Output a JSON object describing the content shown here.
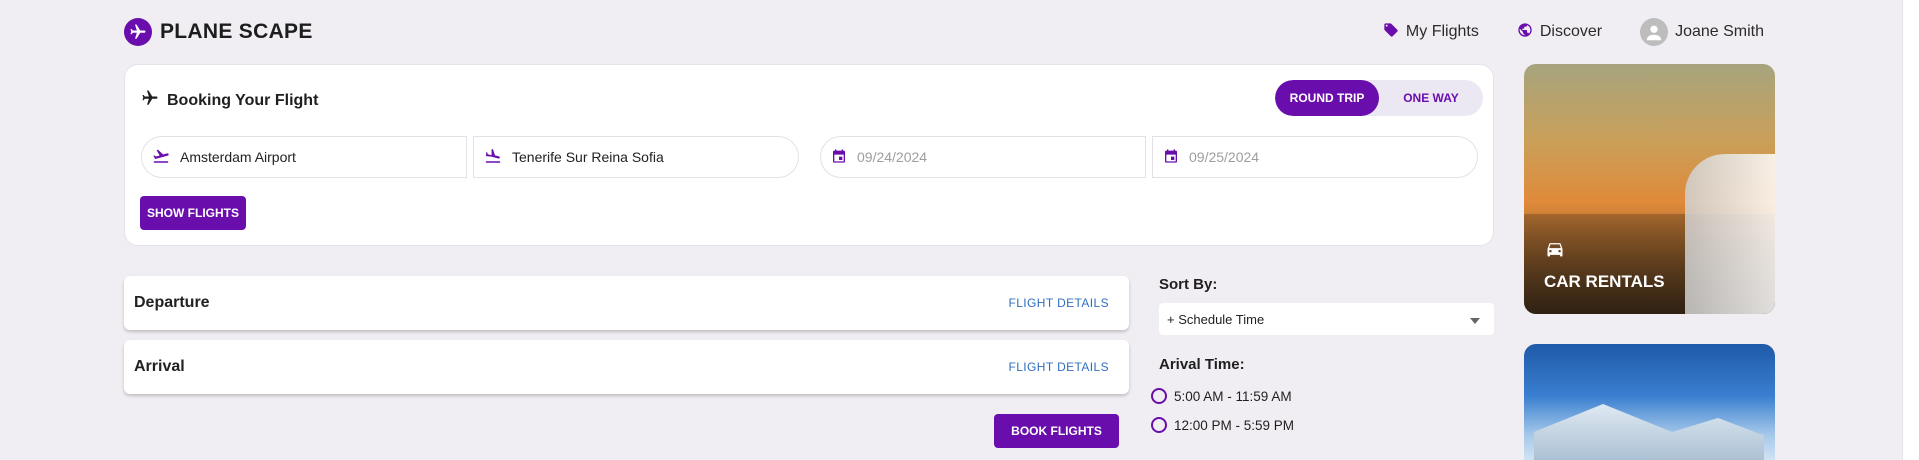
{
  "app": {
    "name": "PLANE SCAPE"
  },
  "nav": {
    "my_flights": "My Flights",
    "discover": "Discover",
    "user_name": "Joane Smith"
  },
  "booking": {
    "title": "Booking Your Flight",
    "trip_types": [
      "ROUND TRIP",
      "ONE WAY"
    ],
    "selected_trip_type": "ROUND TRIP",
    "from": "Amsterdam Airport",
    "to": "Tenerife Sur Reina Sofia",
    "depart_date_placeholder": "09/24/2024",
    "return_date_placeholder": "09/25/2024",
    "show_flights_label": "SHOW FLIGHTS"
  },
  "results": {
    "departure_title": "Departure",
    "arrival_title": "Arrival",
    "flight_details_label": "FLIGHT DETAILS",
    "book_flights_label": "BOOK FLIGHTS"
  },
  "filters": {
    "sort_label": "Sort By:",
    "sort_value": "+ Schedule Time",
    "arrival_label": "Arival Time:",
    "arrival_options": [
      "5:00 AM - 11:59 AM",
      "12:00 PM - 5:59 PM"
    ]
  },
  "promos": {
    "car_rentals": "CAR RENTALS"
  },
  "colors": {
    "brand": "#6a0dad",
    "link": "#2f6fc0",
    "background": "#f1eef3"
  }
}
